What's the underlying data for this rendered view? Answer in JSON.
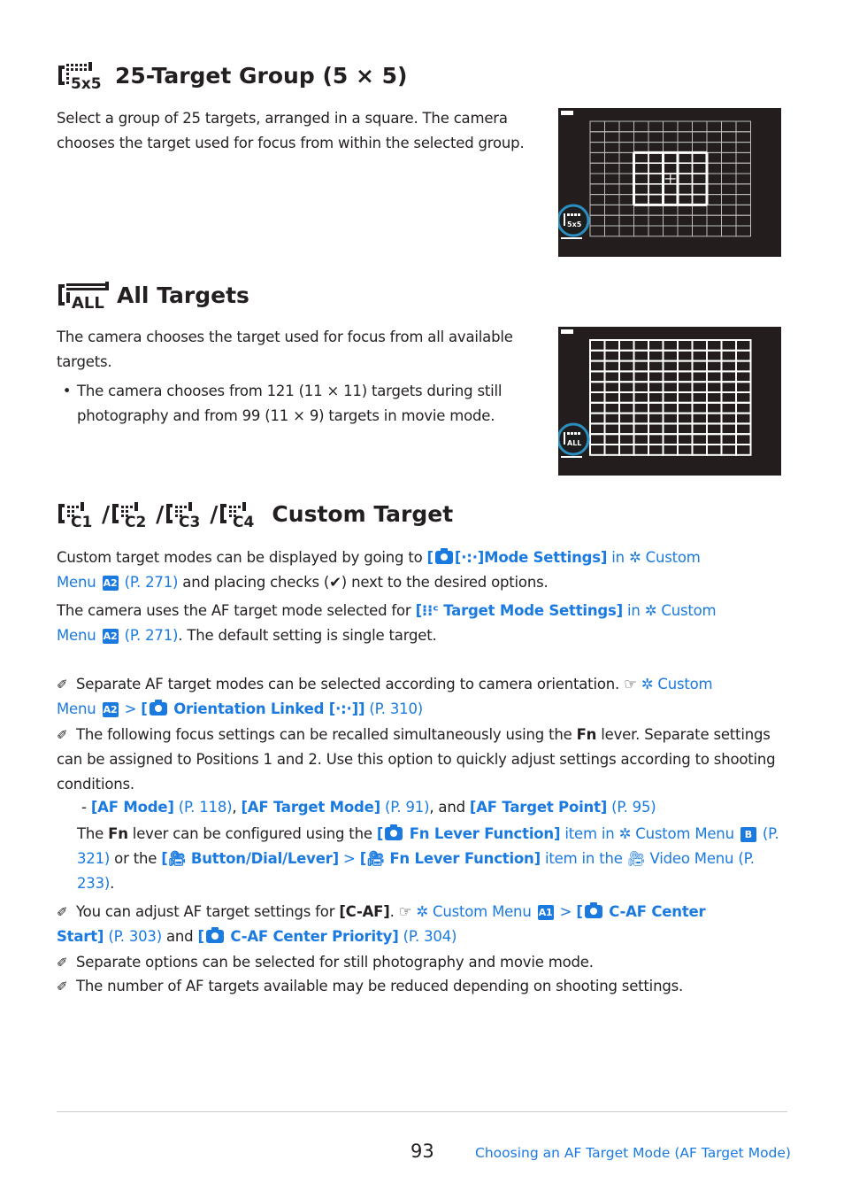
{
  "section1": {
    "icon": "af-25-target-group-icon",
    "title": "25-Target Group (5 × 5)",
    "body": "Select a group of 25 targets, arranged in a square. The camera chooses the target used for focus from within the selected group.",
    "image_icon_label": "5x5"
  },
  "section2": {
    "icon": "af-all-targets-icon",
    "title": "All Targets",
    "body": "The camera chooses the target used for focus from all available targets.",
    "bullet": "The camera chooses from 121 (11 × 11) targets during still photography and from 99 (11 × 9) targets in movie mode.",
    "image_icon_label": "ALL"
  },
  "section3": {
    "icons": [
      "C1",
      "C2",
      "C3",
      "C4"
    ],
    "title": "Custom Target",
    "para1": {
      "t1": "Custom target modes can be displayed by going to ",
      "link": "[",
      "link_label": "Mode Settings]",
      "t2": " in ",
      "menu": "Custom Menu",
      "badge": "A2",
      "page": "(P. 271)",
      "t3": " and placing checks (✔) next to the desired options."
    },
    "para2": {
      "t1": "The camera uses the AF target mode selected for ",
      "link_label": "Target Mode Settings]",
      "t2": " in ",
      "menu": "Custom Menu",
      "badge": "A2",
      "page": "(P. 271)",
      "t3": ". The default setting is single target."
    }
  },
  "notes": [
    {
      "text": "Separate AF target modes can be selected according to camera orientation.",
      "ref_menu": "Custom Menu",
      "ref_badge": "A2",
      "ref_item": "Orientation Linked",
      "ref_page": "(P. 310)"
    },
    {
      "t1": "The following focus settings can be recalled simultaneously using the ",
      "fn": "Fn",
      "t2": " lever. Separate settings can be assigned to Positions 1 and 2. Use this option to quickly adjust settings according to shooting conditions.",
      "list": [
        {
          "label": "[AF Mode]",
          "page": "(P. 118)"
        },
        {
          "label": "[AF Target Mode]",
          "page": "(P. 91)"
        },
        {
          "label": "[AF Target Point]",
          "page": "(P. 95)"
        }
      ],
      "and": ", and ",
      "s1": "The ",
      "s2": " lever can be configured using the ",
      "item1": "Fn Lever Function]",
      "s3": " item in ",
      "menu1": "Custom Menu",
      "badge1": "B",
      "page1": "(P. 321)",
      "s4": " or the ",
      "item2": "Button/Dial/Lever]",
      "item3": "Fn Lever Function]",
      "s5": " item in the ",
      "menu2": "Video Menu",
      "page2": "(P. 233)"
    },
    {
      "t1": "You can adjust AF target settings for ",
      "bold": "[C-AF]",
      "menu": "Custom Menu",
      "badge": "A1",
      "item1": "C-AF Center Start]",
      "page1": "(P. 303)",
      "and": " and ",
      "item2": "C-AF Center Priority]",
      "page2": "(P. 304)"
    },
    {
      "text": "Separate options can be selected for still photography and movie mode."
    },
    {
      "text": "The number of AF targets available may be reduced depending on shooting settings."
    }
  ],
  "footer": {
    "page_number": "93",
    "chapter": "Choosing an AF Target Mode (AF Target Mode)"
  },
  "colors": {
    "link": "#1a7ae0",
    "text": "#231f20",
    "screen_bg": "#231e1d",
    "ring": "#2a8fc0"
  }
}
